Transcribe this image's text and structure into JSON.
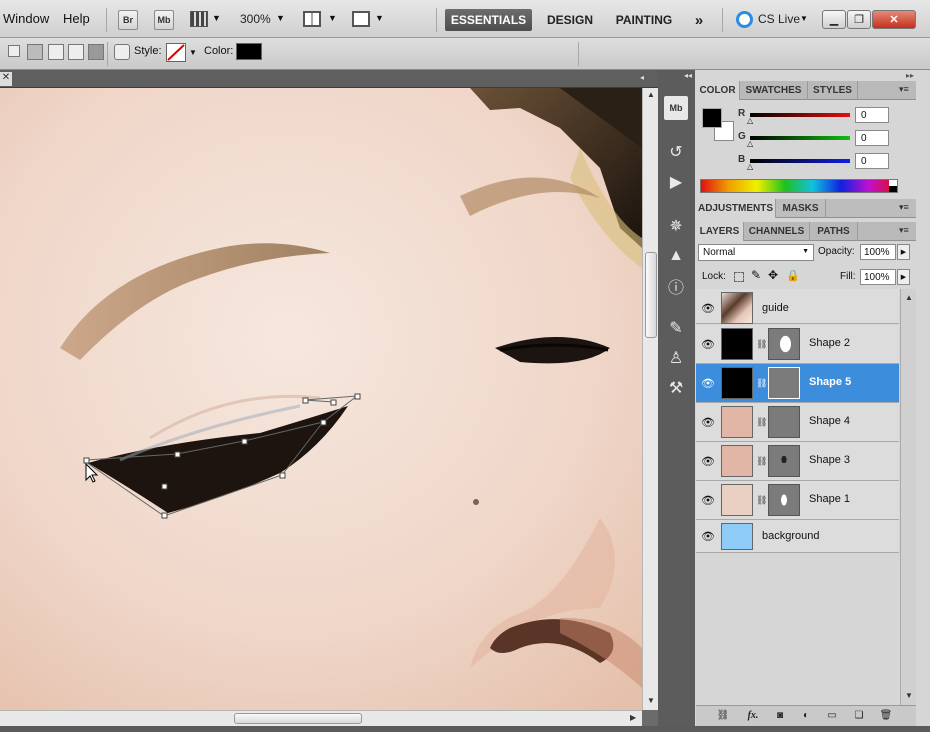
{
  "menu": {
    "window": "Window",
    "help": "Help"
  },
  "appbar": {
    "bridge": "Br",
    "minibridge": "Mb",
    "zoom": "300%",
    "workspaces": [
      "ESSENTIALS",
      "DESIGN",
      "PAINTING"
    ],
    "more": "»",
    "cslive": "CS Live"
  },
  "options": {
    "style_label": "Style:",
    "color_label": "Color:",
    "color_value": "#000000"
  },
  "color_panel": {
    "tabs": [
      "COLOR",
      "SWATCHES",
      "STYLES"
    ],
    "channels": [
      {
        "label": "R",
        "value": "0",
        "color": "#e01010"
      },
      {
        "label": "G",
        "value": "0",
        "color": "#10c010"
      },
      {
        "label": "B",
        "value": "0",
        "color": "#1020e0"
      }
    ]
  },
  "adjust_panel": {
    "tabs": [
      "ADJUSTMENTS",
      "MASKS"
    ]
  },
  "layers_panel": {
    "tabs": [
      "LAYERS",
      "CHANNELS",
      "PATHS"
    ],
    "blend_mode": "Normal",
    "opacity_label": "Opacity:",
    "opacity": "100%",
    "lock_label": "Lock:",
    "fill_label": "Fill:",
    "fill": "100%",
    "layers": [
      {
        "name": "guide",
        "thumb": "#6a4a3a",
        "mask": false,
        "selected": false
      },
      {
        "name": "Shape 2",
        "thumb": "#000000",
        "mask": true,
        "selected": false
      },
      {
        "name": "Shape 5",
        "thumb": "#000000",
        "mask": true,
        "selected": true
      },
      {
        "name": "Shape 4",
        "thumb": "#e2b6a6",
        "mask": true,
        "selected": false
      },
      {
        "name": "Shape 3",
        "thumb": "#e2b6a6",
        "mask": true,
        "selected": false
      },
      {
        "name": "Shape 1",
        "thumb": "#ead0c2",
        "mask": true,
        "selected": false
      },
      {
        "name": "background",
        "thumb": "#8fcbf7",
        "mask": false,
        "selected": false
      }
    ]
  }
}
